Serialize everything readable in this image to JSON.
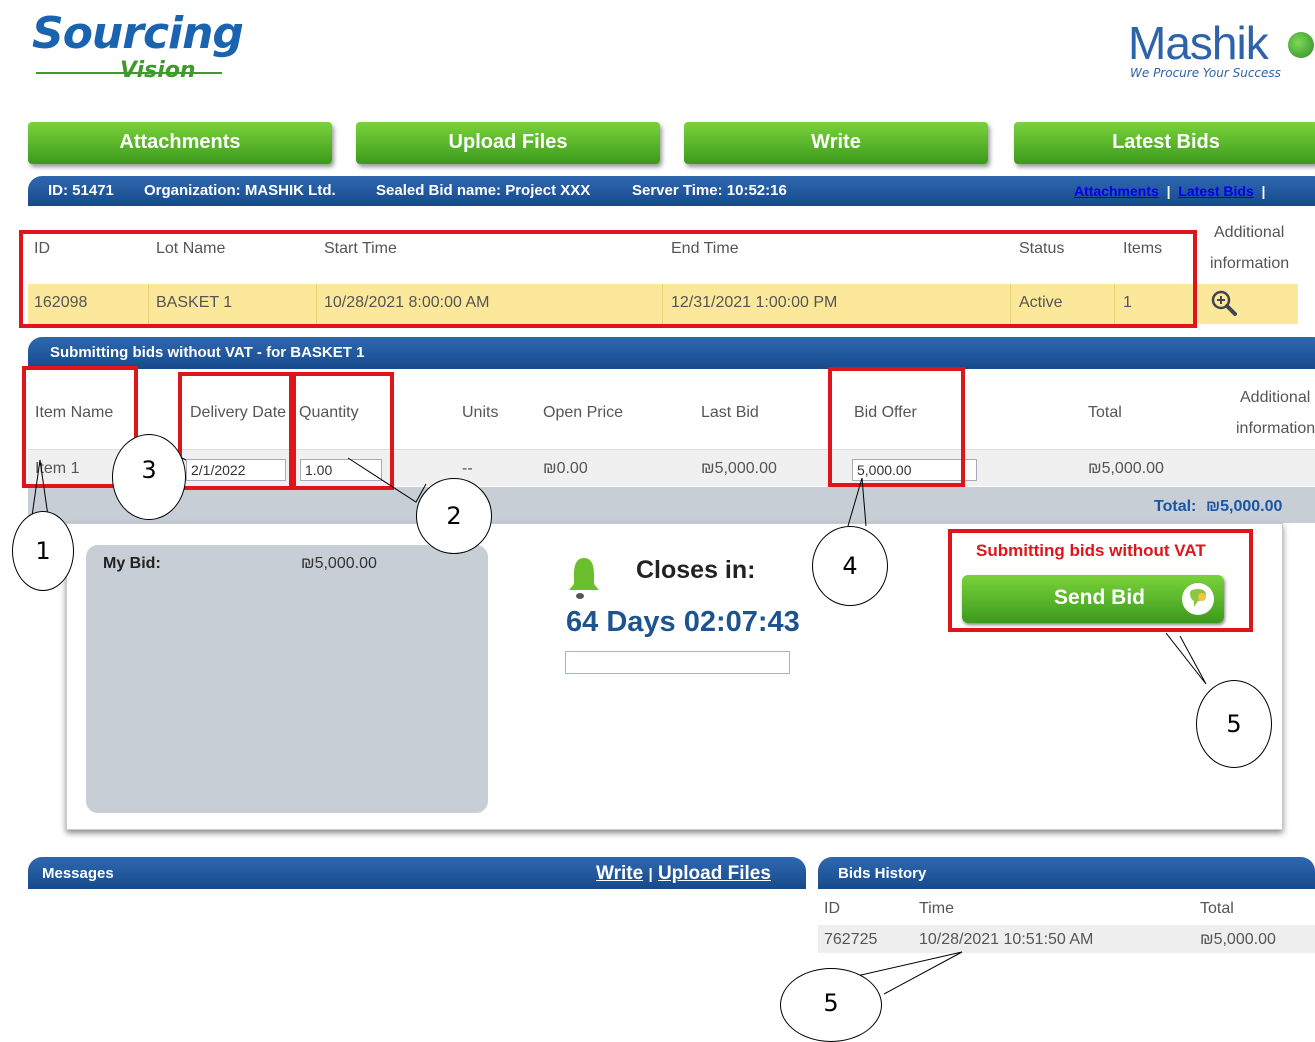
{
  "logos": {
    "sourcing_main": "Sourcing",
    "sourcing_sub": "Vision",
    "mashik_main": "Mashik",
    "mashik_tagline": "We Procure Your Success"
  },
  "nav": [
    "Attachments",
    "Upload Files",
    "Write",
    "Latest Bids"
  ],
  "info_bar": {
    "id": "ID: 51471",
    "organization": "Organization: MASHIK Ltd.",
    "sealed_bid": "Sealed Bid name: Project XXX",
    "server_time": "Server Time: 10:52:16",
    "link_attachments": "Attachments",
    "link_latest_bids": "Latest Bids",
    "sep": "|"
  },
  "lot_table": {
    "headers": [
      "ID",
      "Lot Name",
      "Start Time",
      "End Time",
      "Status",
      "Items",
      "Additional",
      "information"
    ],
    "row": [
      "162098",
      "BASKET 1",
      "10/28/2021 8:00:00 AM",
      "12/31/2021 1:00:00 PM",
      "Active",
      "1"
    ]
  },
  "section_title": "Submitting bids without VAT - for BASKET 1",
  "item_table": {
    "headers": [
      "Item Name",
      "Delivery Date",
      "Quantity",
      "Units",
      "Open Price",
      "Last Bid",
      "Bid Offer",
      "Total",
      "Additional",
      "information"
    ],
    "row": {
      "item_name": "Item 1",
      "delivery_date": "2/1/2022",
      "quantity": "1.00",
      "units": "--",
      "open_price": "₪0.00",
      "last_bid": "₪5,000.00",
      "bid_offer": "5,000.00",
      "total": "₪5,000.00"
    },
    "grand_total_label": "Total:",
    "grand_total": "₪5,000.00"
  },
  "bid_panel": {
    "my_bid_label": "My Bid:",
    "my_bid_value": "₪5,000.00",
    "closes_label": "Closes in:",
    "countdown": "64 Days 02:07:43",
    "vat_notice": "Submitting bids without VAT",
    "send_label": "Send Bid"
  },
  "messages": {
    "title": "Messages",
    "link_write": "Write",
    "sep": "|",
    "link_upload": "Upload Files"
  },
  "bids_history": {
    "title": "Bids History",
    "headers": [
      "ID",
      "Time",
      "Total"
    ],
    "row": [
      "762725",
      "10/28/2021 10:51:50 AM",
      "₪5,000.00"
    ]
  },
  "callouts": [
    "1",
    "2",
    "3",
    "4",
    "5",
    "5"
  ],
  "colors": {
    "nav_green": "#4fae24",
    "bar_blue": "#1d538f",
    "highlight_red": "#e0141b",
    "row_yellow": "#fbe89a"
  }
}
